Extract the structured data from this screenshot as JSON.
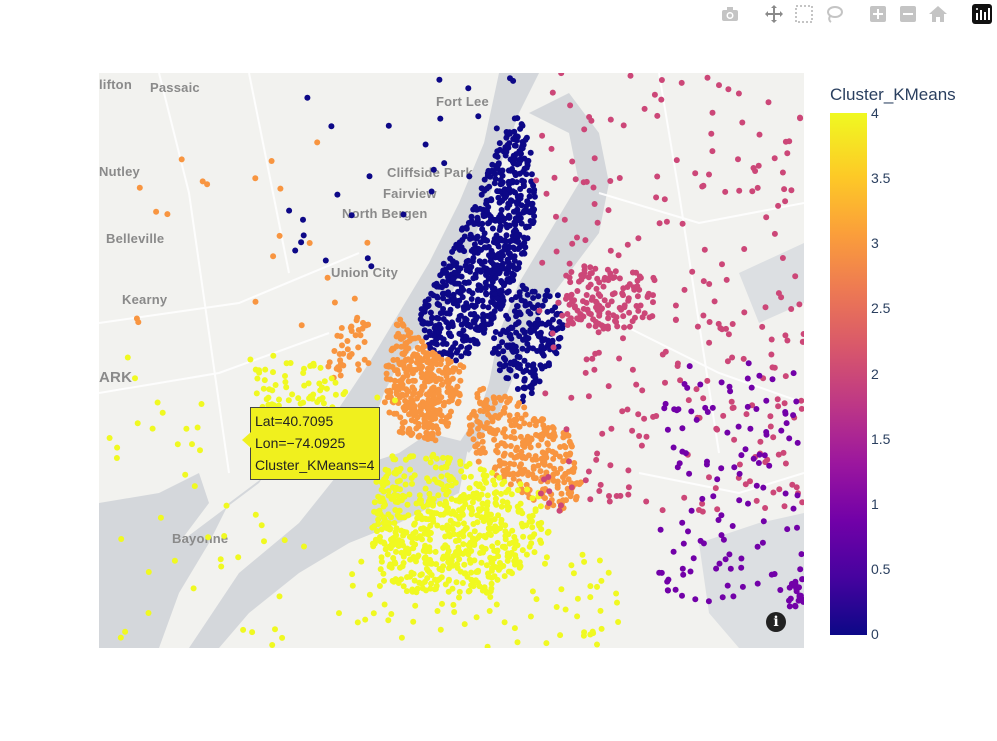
{
  "modebar": {
    "buttons": [
      {
        "name": "camera-icon",
        "title": "Download plot as a png"
      },
      {
        "name": "pan-icon",
        "title": "Pan"
      },
      {
        "name": "box-select-icon",
        "title": "Box Select"
      },
      {
        "name": "lasso-select-icon",
        "title": "Lasso Select"
      },
      {
        "name": "zoom-in-icon",
        "title": "Zoom in"
      },
      {
        "name": "zoom-out-icon",
        "title": "Zoom out"
      },
      {
        "name": "reset-view-icon",
        "title": "Reset view"
      },
      {
        "name": "plotly-logo-icon",
        "title": "Produced with Plotly"
      }
    ]
  },
  "map": {
    "places": {
      "clifton": "lifton",
      "passaic": "Passaic",
      "fort_lee": "Fort Lee",
      "nutley": "Nutley",
      "cliffside_park": "Cliffside Park",
      "fairview": "Fairview",
      "north_bergen": "North Bergen",
      "belleville": "Belleville",
      "union_city": "Union City",
      "kearny": "Kearny",
      "newark": "ARK",
      "bayonne": "Bayonne"
    },
    "info_glyph": "i"
  },
  "tooltip": {
    "lat": "Lat=40.7095",
    "lon": "Lon=−74.0925",
    "cluster": "Cluster_KMeans=4"
  },
  "colorbar": {
    "title": "Cluster_KMeans",
    "ticks": [
      "4",
      "3.5",
      "3",
      "2.5",
      "2",
      "1.5",
      "1",
      "0.5",
      "0"
    ],
    "colors": [
      "#0d0887",
      "#46039f",
      "#7201a8",
      "#9c179e",
      "#bd3786",
      "#d8576b",
      "#ed7953",
      "#fb9f3a",
      "#fdca26",
      "#f0f921"
    ]
  },
  "clusters": [
    {
      "id": 0,
      "color": "#0d0887"
    },
    {
      "id": 1,
      "color": "#7201a8"
    },
    {
      "id": 2,
      "color": "#cc4778"
    },
    {
      "id": 3,
      "color": "#f89540"
    },
    {
      "id": 4,
      "color": "#f0f921"
    }
  ]
}
